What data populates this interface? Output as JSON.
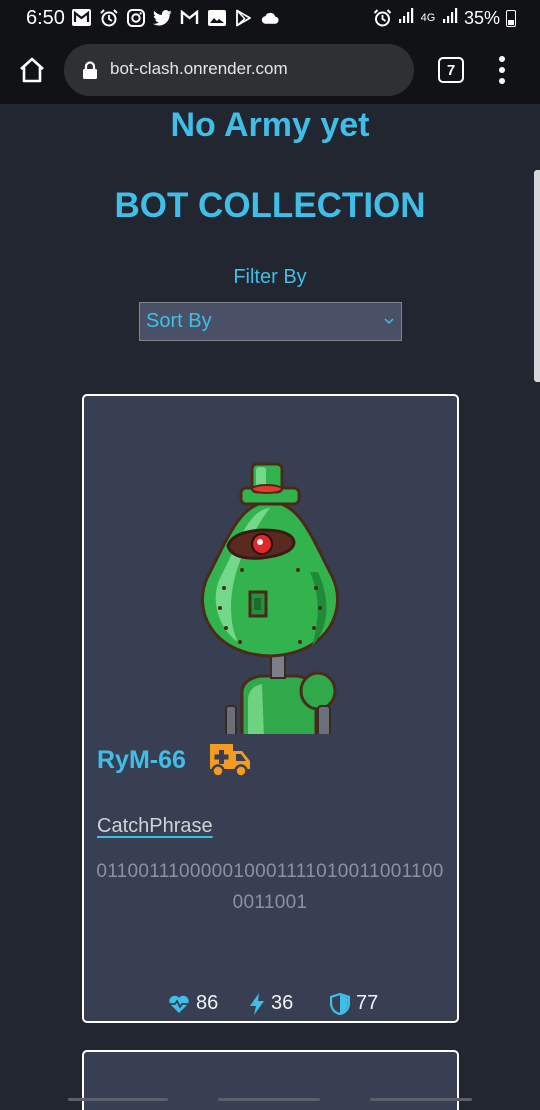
{
  "status_bar": {
    "time": "6:50",
    "network": "4G",
    "battery": "35%",
    "left_icons": [
      "gmail-icon",
      "alarm-icon",
      "instagram-icon",
      "twitter-icon",
      "gmail-icon",
      "gallery-icon",
      "play-store-icon",
      "cloud-icon"
    ]
  },
  "browser": {
    "url": "bot-clash.onrender.com",
    "tab_count": "7"
  },
  "page": {
    "army_title": "No Army yet",
    "collection_title": "BOT COLLECTION",
    "filter_label": "Filter By",
    "sort_select": {
      "selected": "Sort By"
    }
  },
  "bots": [
    {
      "name": "RyM-66",
      "class_icon": "ambulance-icon",
      "catchphrase_label": "CatchPhrase",
      "catchphrase": "0110011100000100011110100110011000011001",
      "health": "86",
      "damage": "36",
      "armor": "77"
    }
  ],
  "colors": {
    "accent": "#3fbfe8",
    "background": "#222631",
    "card": "#383f52",
    "class_icon": "#f59a23"
  }
}
